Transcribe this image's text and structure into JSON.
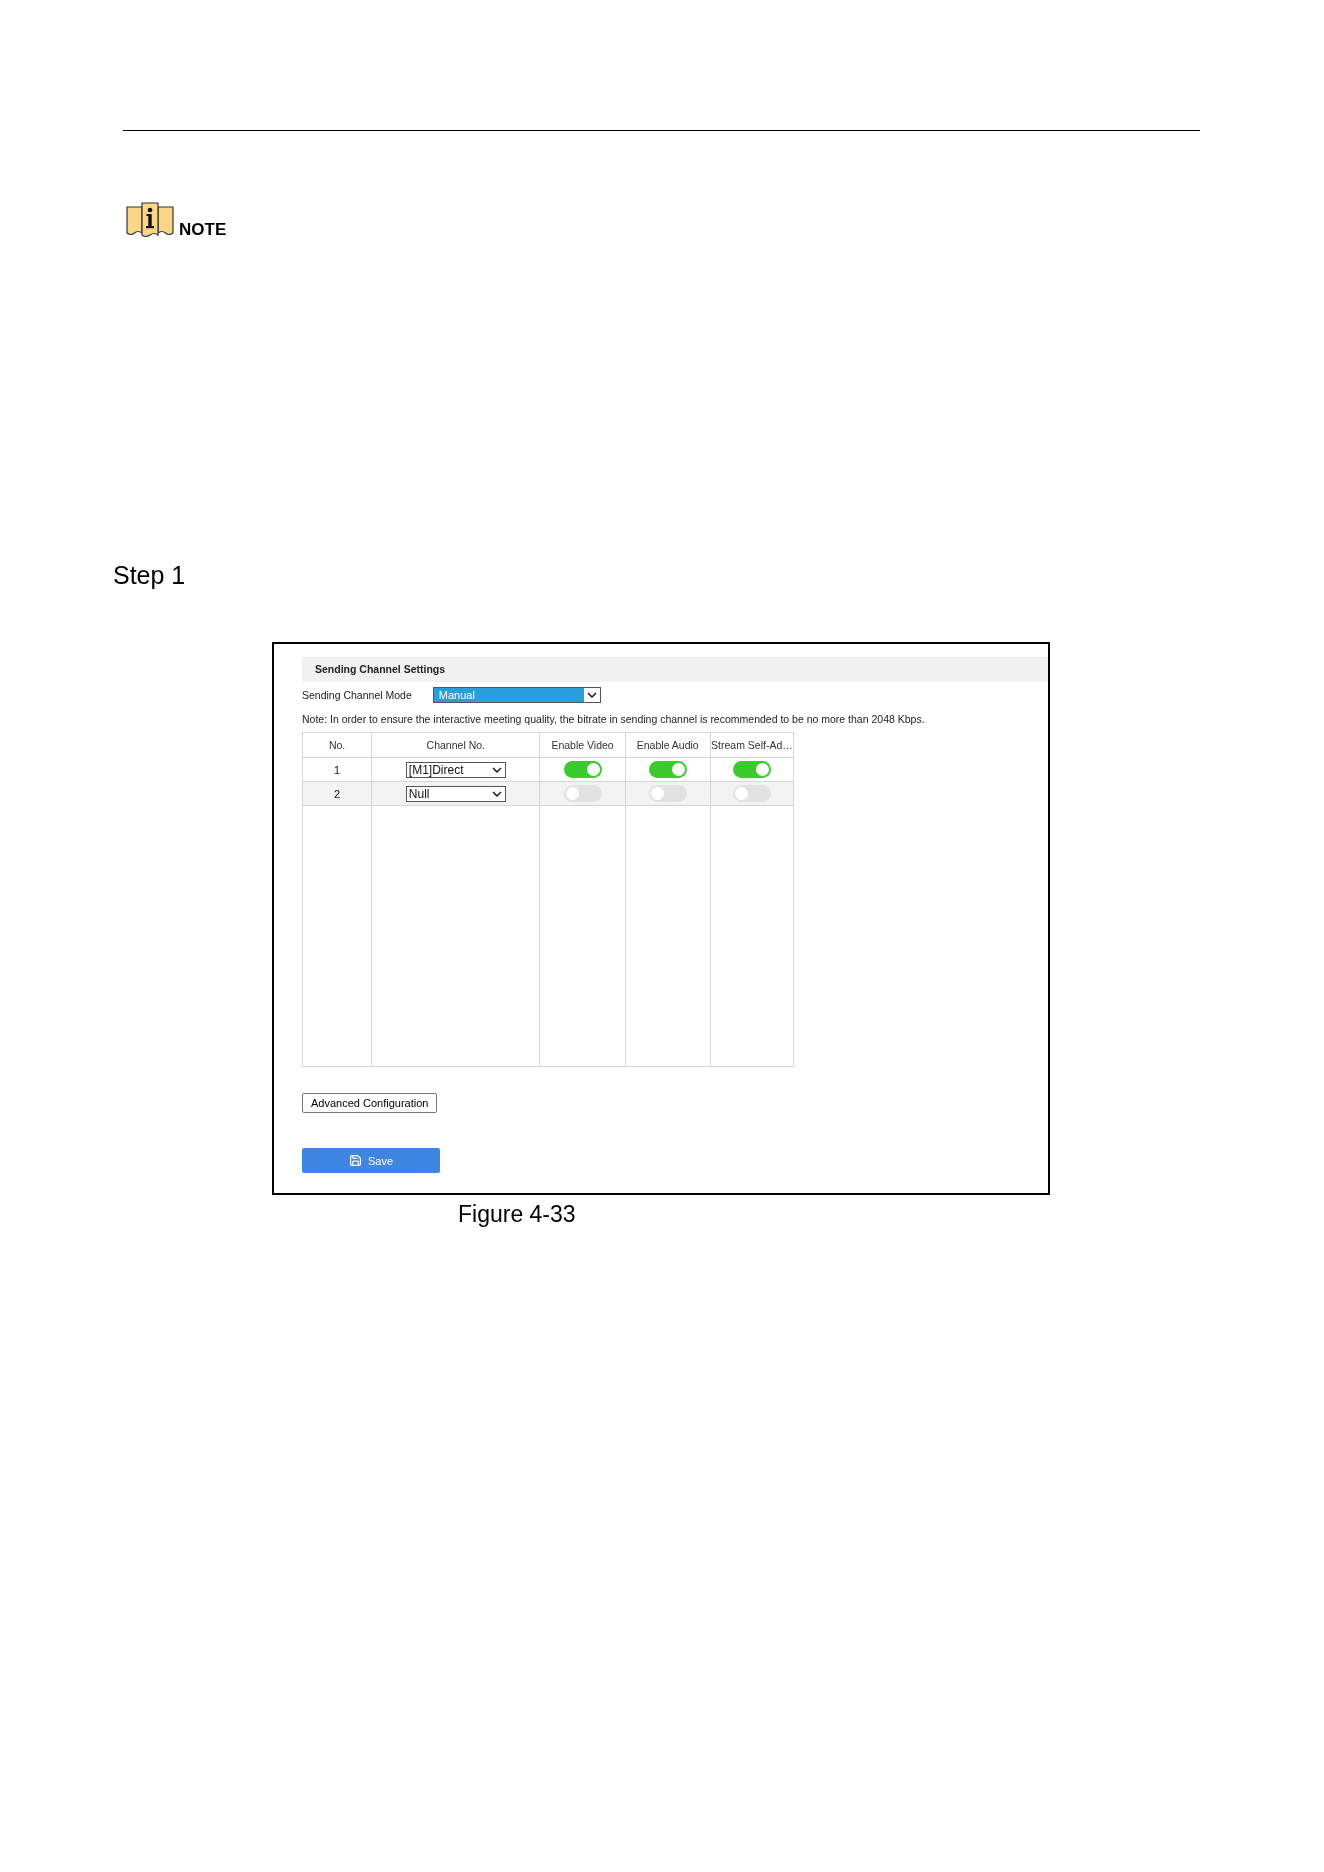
{
  "note_label": "NOTE",
  "step_label": "Step 1",
  "figure": {
    "section_title": "Sending Channel Settings",
    "mode": {
      "label": "Sending Channel Mode",
      "value": "Manual",
      "highlighted": true
    },
    "note": "Note: In order to ensure the interactive meeting quality, the bitrate in sending channel is recommended to be no more than 2048 Kbps.",
    "table": {
      "columns": [
        "No.",
        "Channel No.",
        "Enable Video",
        "Enable Audio",
        "Stream Self-Ad…"
      ],
      "rows": [
        {
          "no": "1",
          "channel_no": "[M1]Direct",
          "switches": [
            {
              "on": true
            },
            {
              "on": true
            },
            {
              "on": true
            }
          ]
        },
        {
          "no": "2",
          "channel_no": "Null",
          "switches": [
            {
              "on": false
            },
            {
              "on": false
            },
            {
              "on": false
            }
          ]
        }
      ]
    },
    "buttons": {
      "advanced": "Advanced Configuration",
      "save": "Save"
    }
  },
  "caption": "Figure 4-33"
}
